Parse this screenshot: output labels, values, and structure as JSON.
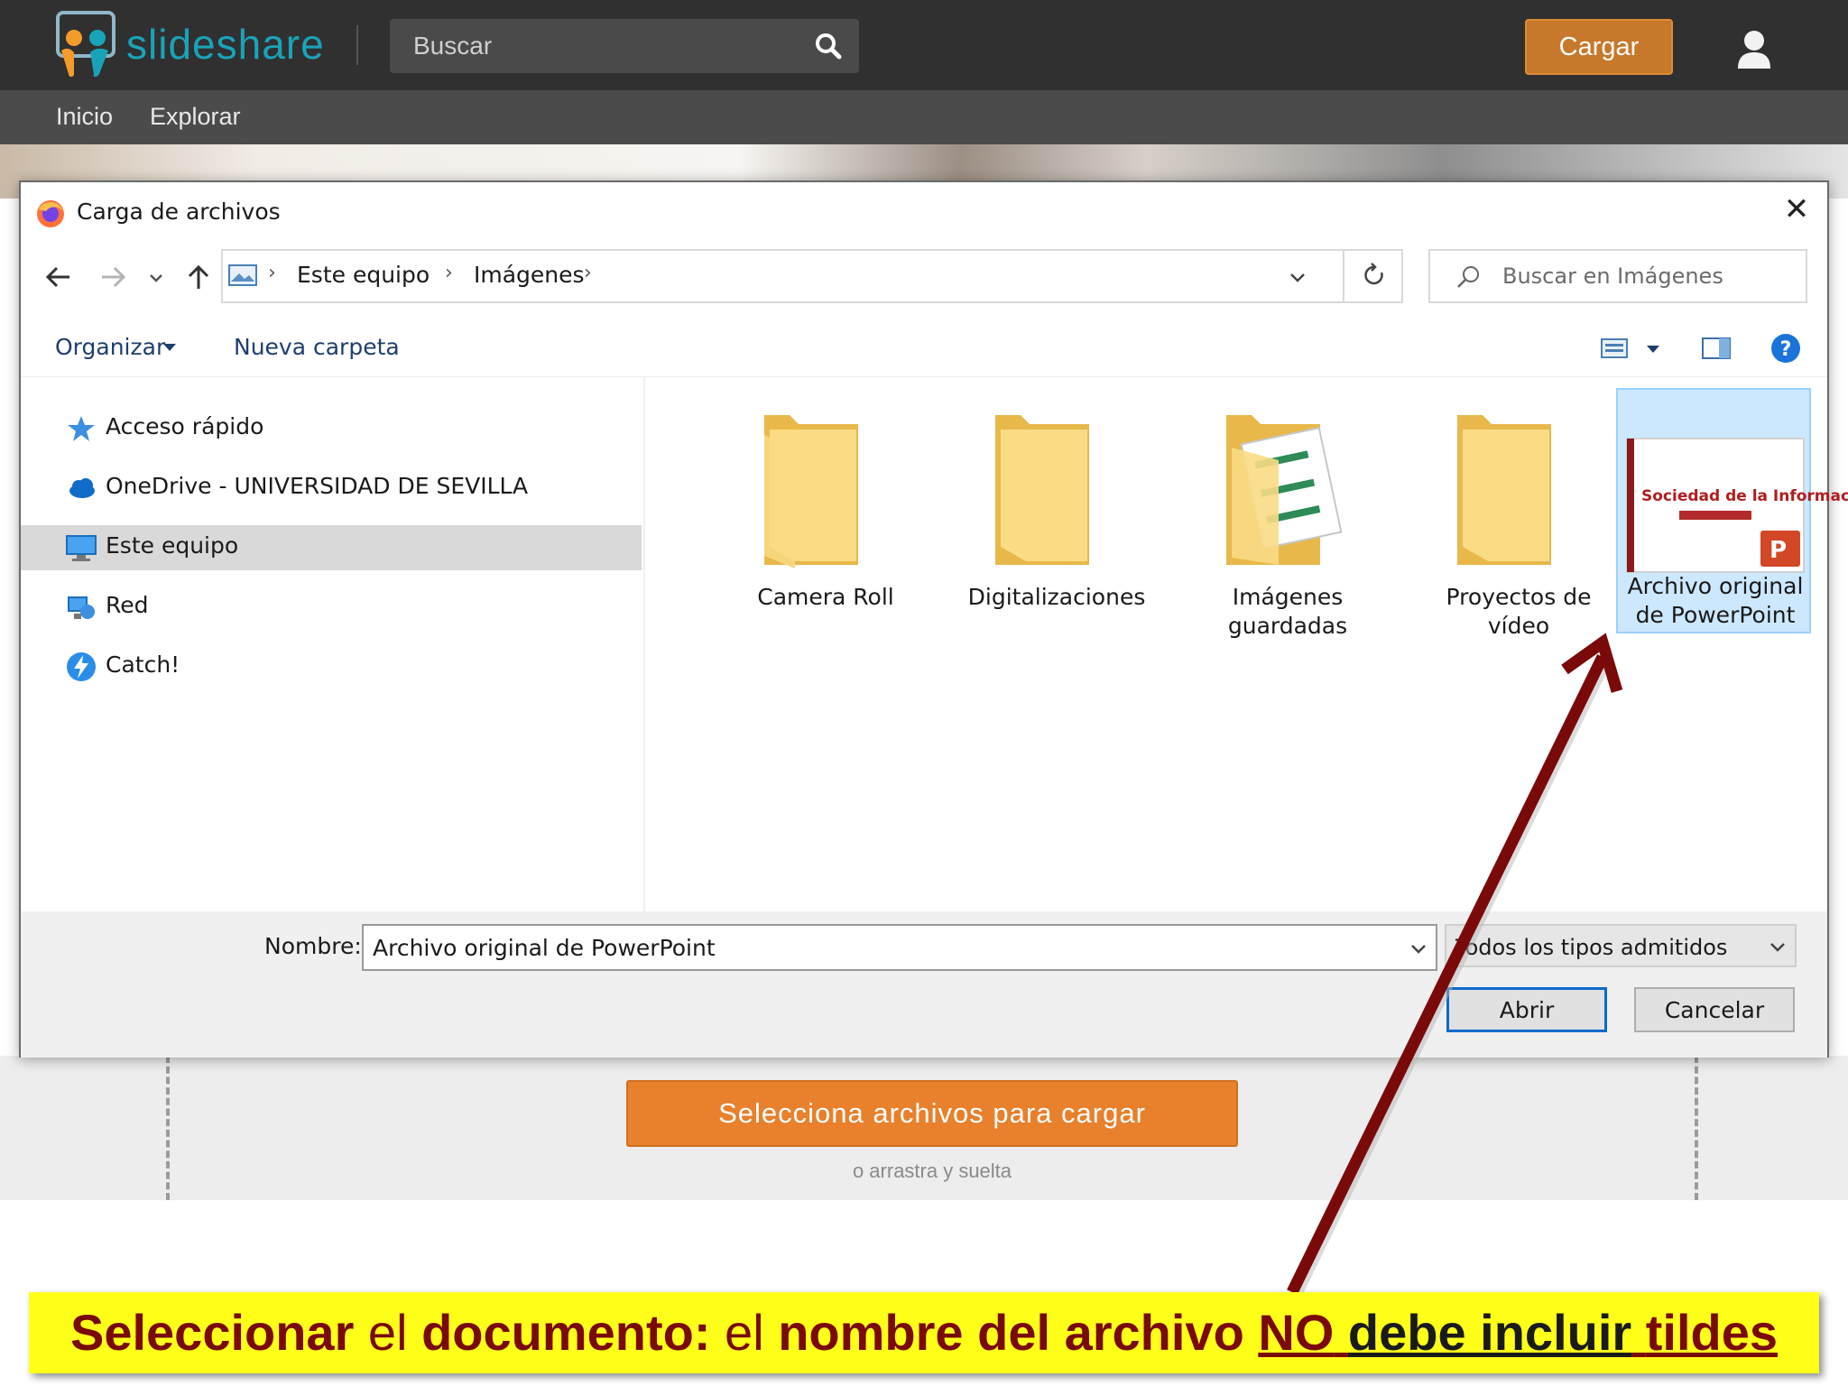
{
  "site": {
    "logo_text": "slideshare",
    "search_placeholder": "Buscar",
    "upload_label": "Cargar",
    "nav": [
      "Inicio",
      "Explorar"
    ]
  },
  "page": {
    "select_button": "Selecciona archivos para cargar",
    "drag_hint": "o arrastra y suelta"
  },
  "dialog": {
    "title": "Carga de archivos",
    "breadcrumb": [
      "Este equipo",
      "Imágenes"
    ],
    "search_placeholder": "Buscar en Imágenes",
    "toolbar": {
      "organize": "Organizar",
      "new_folder": "Nueva carpeta"
    },
    "nav_items": [
      "Acceso rápido",
      "OneDrive - UNIVERSIDAD DE SEVILLA",
      "Este equipo",
      "Red",
      "Catch!"
    ],
    "selected_nav": "Este equipo",
    "files": [
      {
        "name": "Camera Roll",
        "kind": "folder-icon"
      },
      {
        "name": "Digitalizaciones",
        "kind": "folder-icon"
      },
      {
        "name": "Imágenes guardadas",
        "kind": "folder-with-documents-icon"
      },
      {
        "name": "Proyectos de vídeo",
        "kind": "folder-icon"
      },
      {
        "name": "Archivo original de PowerPoint",
        "kind": "powerpoint-file-icon",
        "selected": true
      }
    ],
    "thumbnail_title": "Sociedad de la Información",
    "name_label": "Nombre:",
    "name_value": "Archivo original de PowerPoint",
    "type_value": "Todos los tipos admitidos",
    "open_label": "Abrir",
    "cancel_label": "Cancelar"
  },
  "caption": {
    "part1": "Seleccionar",
    "part2": " el ",
    "part3": "documento:",
    "part4": " el ",
    "part5": "nombre del archivo ",
    "part6": "NO",
    "part7": " ",
    "part8": "debe incluir",
    "part9": " ",
    "part10": "tildes"
  },
  "colors": {
    "brand_teal": "#19a3b8",
    "upload_orange": "#c8782a",
    "select_orange": "#e8802c",
    "selection_blue": "#cce8ff",
    "caption_yellow": "#ffff1a",
    "caption_red": "#7a0a0a"
  }
}
